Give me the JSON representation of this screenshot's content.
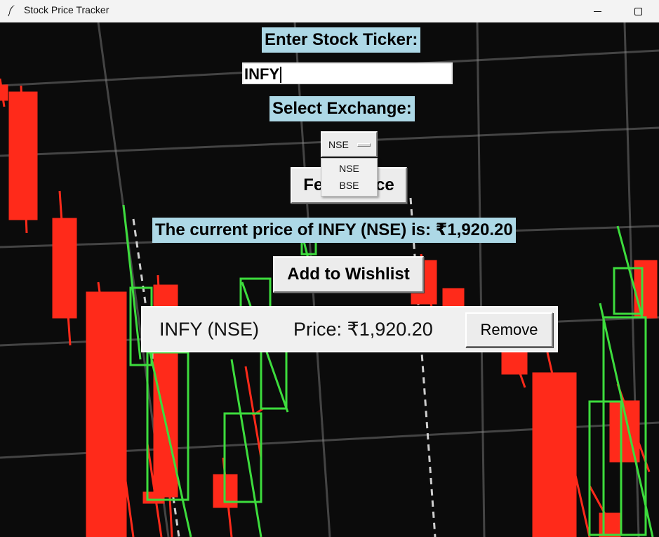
{
  "window": {
    "title": "Stock Price Tracker",
    "icon": "feather-icon"
  },
  "form": {
    "ticker_label": "Enter Stock Ticker:",
    "ticker_value": "INFY",
    "exchange_label": "Select Exchange:",
    "exchange_value": "NSE",
    "exchange_options": [
      "NSE",
      "BSE"
    ],
    "fetch_label": "Fetch Price",
    "result_text": "The current price of INFY (NSE) is: ₹1,920.20",
    "wishlist_button_label": "Add to Wishlist"
  },
  "wishlist": {
    "items": [
      {
        "name": "INFY (NSE)",
        "price": "Price: ₹1,920.20",
        "remove_label": "Remove"
      }
    ]
  },
  "colors": {
    "label_bg": "#add8e6",
    "candle_up": "#3ddc3d",
    "candle_down": "#ff2a1a",
    "chart_bg": "#0b0b0b"
  }
}
